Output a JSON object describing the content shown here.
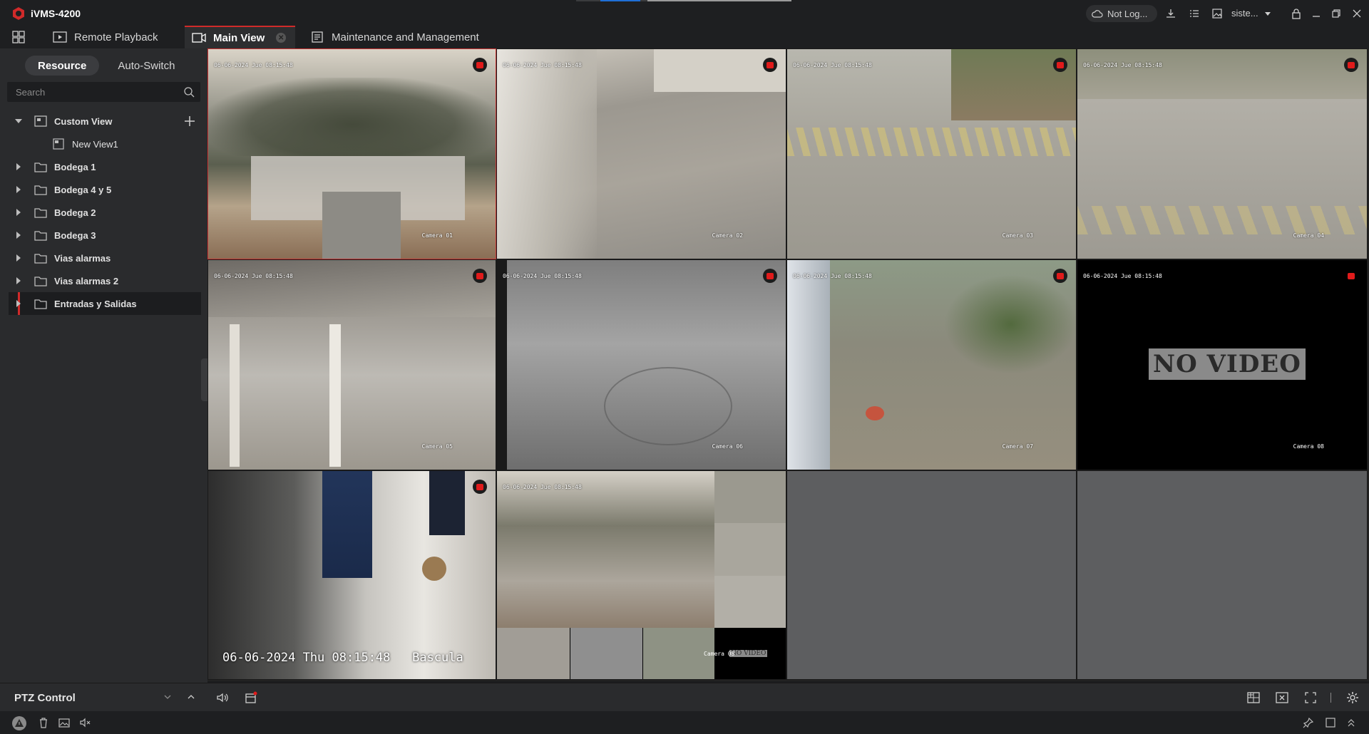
{
  "app": {
    "title": "iVMS-4200",
    "brand_color": "#d02a2a"
  },
  "titlebar": {
    "cloud_status": "Not Log...",
    "user_menu": "siste..."
  },
  "tabs": [
    {
      "label": "Remote Playback",
      "icon": "playback-icon"
    },
    {
      "label": "Main View",
      "icon": "main-view-icon",
      "active": true
    },
    {
      "label": "Maintenance and Management",
      "icon": "maintenance-icon"
    }
  ],
  "sidebar": {
    "switch": {
      "resource": "Resource",
      "auto_switch": "Auto-Switch"
    },
    "search_placeholder": "Search",
    "tree": [
      {
        "label": "Custom View",
        "expanded": true
      },
      {
        "label": "New View1",
        "child": true
      },
      {
        "label": "Bodega 1"
      },
      {
        "label": "Bodega 4 y 5"
      },
      {
        "label": "Bodega 2"
      },
      {
        "label": "Bodega 3"
      },
      {
        "label": "Vias alarmas"
      },
      {
        "label": "Vias alarmas 2"
      },
      {
        "label": "Entradas y Salidas",
        "selected": true
      }
    ],
    "ptz_label": "PTZ Control"
  },
  "cameras": [
    {
      "time": "06-06-2024 Jue 08:15:48",
      "name": "Camera 01"
    },
    {
      "time": "06-06-2024 Jue 08:15:48",
      "name": "Camera 02"
    },
    {
      "time": "06-06-2024 Jue 08:15:48",
      "name": "Camera 03"
    },
    {
      "time": "06-06-2024 Jue 08:15:48",
      "name": "Camera 04"
    },
    {
      "time": "06-06-2024 Jue 08:15:48",
      "name": "Camera 05"
    },
    {
      "time": "06-06-2024 Jue 08:15:48",
      "name": "Camera 06"
    },
    {
      "time": "06-06-2024 Jue 08:15:48",
      "name": "Camera 07"
    },
    {
      "time": "06-06-2024 Jue 08:15:48",
      "name": "Camera 08",
      "no_video": "NO VIDEO"
    },
    {
      "osd": "06-06-2024 Thu 08:15:48   Bascula"
    },
    {
      "time": "06-06-2024 Jue 08:15:48",
      "name": "Camera 08",
      "no_video": "NO VIDEO"
    }
  ]
}
